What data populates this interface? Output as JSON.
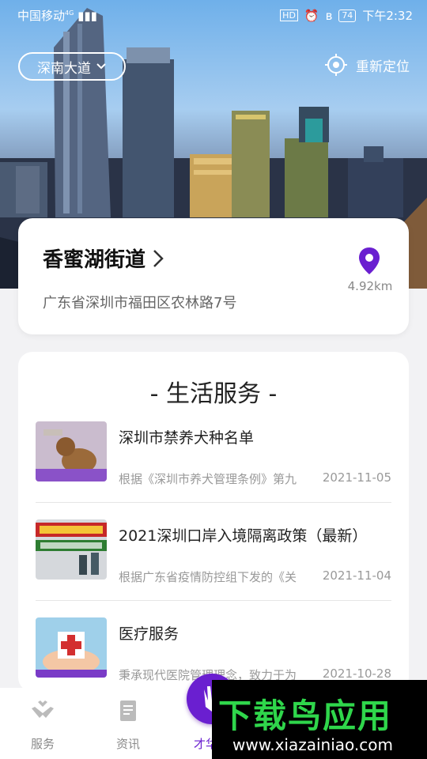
{
  "status_bar": {
    "carrier": "中国移动",
    "network": "4G",
    "hd": "HD",
    "battery": "74",
    "time": "下午2:32"
  },
  "header": {
    "location_selector": "深南大道",
    "relocate_label": "重新定位"
  },
  "location_card": {
    "name": "香蜜湖街道",
    "address": "广东省深圳市福田区农林路7号",
    "distance": "4.92km"
  },
  "services": {
    "heading": "- 生活服务 -",
    "items": [
      {
        "title": "深圳市禁养犬种名单",
        "desc": "根据《深圳市养犬管理条例》第九",
        "date": "2021-11-05",
        "thumb": "dog-photo"
      },
      {
        "title": "2021深圳口岸入境隔离政策（最新）",
        "desc": "根据广东省疫情防控组下发的《关",
        "date": "2021-11-04",
        "thumb": "quarantine-poster"
      },
      {
        "title": "医疗服务",
        "desc": "秉承现代医院管理理念，致力于为",
        "date": "2021-10-28",
        "thumb": "medical-cross"
      }
    ]
  },
  "tabbar": {
    "tabs": [
      {
        "label": "服务",
        "icon": "hands-service-icon"
      },
      {
        "label": "资讯",
        "icon": "document-icon"
      },
      {
        "label": "才华",
        "icon": "hand-fab-icon"
      }
    ]
  },
  "watermark": {
    "title": "下载鸟应用",
    "url": "www.xiazainiao.com"
  },
  "colors": {
    "accent": "#6a1fd0",
    "watermark_green": "#2fd64b"
  }
}
